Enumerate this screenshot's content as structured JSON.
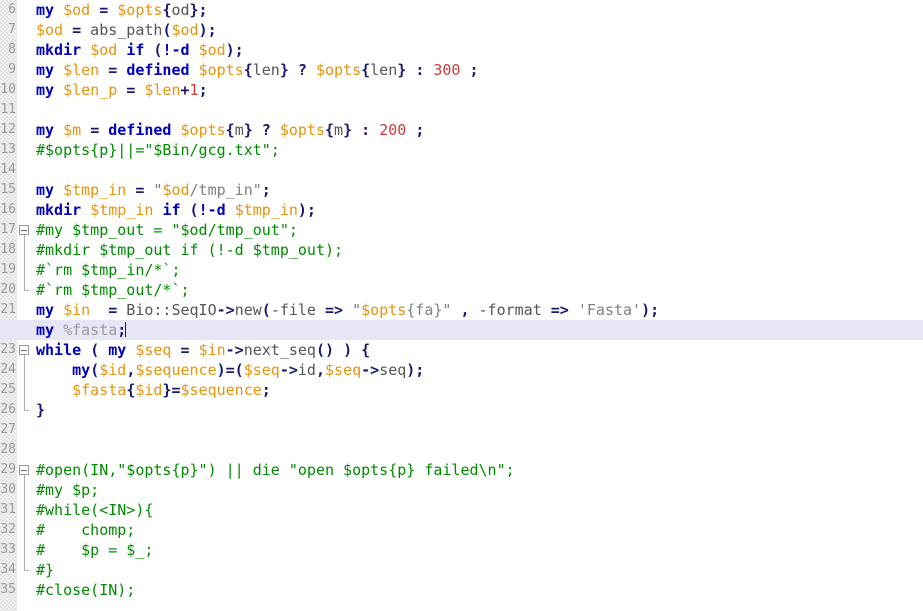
{
  "editor": {
    "language": "Perl",
    "colors": {
      "background": "#ffffff",
      "keyword": "#0000bb",
      "variable": "#e8940c",
      "operator": "#191970",
      "number": "#cc3b3b",
      "comment": "#008c00",
      "string": "#808080",
      "plain": "#555555",
      "current_line": "#e6e6f7",
      "gutter": "#f2f2f2",
      "fold_marker": "#9b9b9b"
    },
    "caret_line_index": 16
  },
  "lines": [
    {
      "number": "6",
      "fold": "none",
      "current": false,
      "tokens": [
        {
          "t": "kw",
          "s": "my"
        },
        {
          "t": "pln",
          "s": " "
        },
        {
          "t": "var",
          "s": "$od"
        },
        {
          "t": "pln",
          "s": " "
        },
        {
          "t": "op",
          "s": "="
        },
        {
          "t": "pln",
          "s": " "
        },
        {
          "t": "var",
          "s": "$opts"
        },
        {
          "t": "op",
          "s": "{"
        },
        {
          "t": "pln",
          "s": "od"
        },
        {
          "t": "op",
          "s": "};"
        }
      ]
    },
    {
      "number": "7",
      "fold": "none",
      "current": false,
      "tokens": [
        {
          "t": "var",
          "s": "$od"
        },
        {
          "t": "pln",
          "s": " "
        },
        {
          "t": "op",
          "s": "="
        },
        {
          "t": "pln",
          "s": " abs_path"
        },
        {
          "t": "op",
          "s": "("
        },
        {
          "t": "var",
          "s": "$od"
        },
        {
          "t": "op",
          "s": ");"
        }
      ]
    },
    {
      "number": "8",
      "fold": "none",
      "current": false,
      "tokens": [
        {
          "t": "kw",
          "s": "mkdir"
        },
        {
          "t": "pln",
          "s": " "
        },
        {
          "t": "var",
          "s": "$od"
        },
        {
          "t": "pln",
          "s": " "
        },
        {
          "t": "kw",
          "s": "if"
        },
        {
          "t": "pln",
          "s": " "
        },
        {
          "t": "op",
          "s": "("
        },
        {
          "t": "kw",
          "s": "!-d"
        },
        {
          "t": "pln",
          "s": " "
        },
        {
          "t": "var",
          "s": "$od"
        },
        {
          "t": "op",
          "s": ");"
        }
      ]
    },
    {
      "number": "9",
      "fold": "none",
      "current": false,
      "tokens": [
        {
          "t": "kw",
          "s": "my"
        },
        {
          "t": "pln",
          "s": " "
        },
        {
          "t": "var",
          "s": "$len"
        },
        {
          "t": "pln",
          "s": " "
        },
        {
          "t": "op",
          "s": "="
        },
        {
          "t": "pln",
          "s": " "
        },
        {
          "t": "kw",
          "s": "defined"
        },
        {
          "t": "pln",
          "s": " "
        },
        {
          "t": "var",
          "s": "$opts"
        },
        {
          "t": "op",
          "s": "{"
        },
        {
          "t": "pln",
          "s": "len"
        },
        {
          "t": "op",
          "s": "}"
        },
        {
          "t": "pln",
          "s": " "
        },
        {
          "t": "op",
          "s": "?"
        },
        {
          "t": "pln",
          "s": " "
        },
        {
          "t": "var",
          "s": "$opts"
        },
        {
          "t": "op",
          "s": "{"
        },
        {
          "t": "pln",
          "s": "len"
        },
        {
          "t": "op",
          "s": "}"
        },
        {
          "t": "pln",
          "s": " "
        },
        {
          "t": "op",
          "s": ":"
        },
        {
          "t": "pln",
          "s": " "
        },
        {
          "t": "num",
          "s": "300"
        },
        {
          "t": "pln",
          "s": " "
        },
        {
          "t": "op",
          "s": ";"
        }
      ]
    },
    {
      "number": "10",
      "fold": "none",
      "current": false,
      "tokens": [
        {
          "t": "kw",
          "s": "my"
        },
        {
          "t": "pln",
          "s": " "
        },
        {
          "t": "var",
          "s": "$len_p"
        },
        {
          "t": "pln",
          "s": " "
        },
        {
          "t": "op",
          "s": "="
        },
        {
          "t": "pln",
          "s": " "
        },
        {
          "t": "var",
          "s": "$len"
        },
        {
          "t": "op",
          "s": "+"
        },
        {
          "t": "num",
          "s": "1"
        },
        {
          "t": "op",
          "s": ";"
        }
      ]
    },
    {
      "number": "11",
      "fold": "none",
      "current": false,
      "tokens": []
    },
    {
      "number": "12",
      "fold": "none",
      "current": false,
      "tokens": [
        {
          "t": "kw",
          "s": "my"
        },
        {
          "t": "pln",
          "s": " "
        },
        {
          "t": "var",
          "s": "$m"
        },
        {
          "t": "pln",
          "s": " "
        },
        {
          "t": "op",
          "s": "="
        },
        {
          "t": "pln",
          "s": " "
        },
        {
          "t": "kw",
          "s": "defined"
        },
        {
          "t": "pln",
          "s": " "
        },
        {
          "t": "var",
          "s": "$opts"
        },
        {
          "t": "op",
          "s": "{"
        },
        {
          "t": "pln",
          "s": "m"
        },
        {
          "t": "op",
          "s": "}"
        },
        {
          "t": "pln",
          "s": " "
        },
        {
          "t": "op",
          "s": "?"
        },
        {
          "t": "pln",
          "s": " "
        },
        {
          "t": "var",
          "s": "$opts"
        },
        {
          "t": "op",
          "s": "{"
        },
        {
          "t": "pln",
          "s": "m"
        },
        {
          "t": "op",
          "s": "}"
        },
        {
          "t": "pln",
          "s": " "
        },
        {
          "t": "op",
          "s": ":"
        },
        {
          "t": "pln",
          "s": " "
        },
        {
          "t": "num",
          "s": "200"
        },
        {
          "t": "pln",
          "s": " "
        },
        {
          "t": "op",
          "s": ";"
        }
      ]
    },
    {
      "number": "13",
      "fold": "none",
      "current": false,
      "tokens": [
        {
          "t": "cmt",
          "s": "#$opts{p}||=\"$Bin/gcg.txt\";"
        }
      ]
    },
    {
      "number": "14",
      "fold": "none",
      "current": false,
      "tokens": []
    },
    {
      "number": "15",
      "fold": "none",
      "current": false,
      "tokens": [
        {
          "t": "kw",
          "s": "my"
        },
        {
          "t": "pln",
          "s": " "
        },
        {
          "t": "var",
          "s": "$tmp_in"
        },
        {
          "t": "pln",
          "s": " "
        },
        {
          "t": "op",
          "s": "="
        },
        {
          "t": "pln",
          "s": " "
        },
        {
          "t": "str",
          "s": "\""
        },
        {
          "t": "var",
          "s": "$od"
        },
        {
          "t": "str",
          "s": "/tmp_in\""
        },
        {
          "t": "op",
          "s": ";"
        }
      ]
    },
    {
      "number": "16",
      "fold": "none",
      "current": false,
      "tokens": [
        {
          "t": "kw",
          "s": "mkdir"
        },
        {
          "t": "pln",
          "s": " "
        },
        {
          "t": "var",
          "s": "$tmp_in"
        },
        {
          "t": "pln",
          "s": " "
        },
        {
          "t": "kw",
          "s": "if"
        },
        {
          "t": "pln",
          "s": " "
        },
        {
          "t": "op",
          "s": "("
        },
        {
          "t": "kw",
          "s": "!-d"
        },
        {
          "t": "pln",
          "s": " "
        },
        {
          "t": "var",
          "s": "$tmp_in"
        },
        {
          "t": "op",
          "s": ");"
        }
      ]
    },
    {
      "number": "17",
      "fold": "start",
      "current": false,
      "tokens": [
        {
          "t": "cmt",
          "s": "#my $tmp_out = \"$od/tmp_out\";"
        }
      ]
    },
    {
      "number": "18",
      "fold": "mid",
      "current": false,
      "tokens": [
        {
          "t": "cmt",
          "s": "#mkdir $tmp_out if (!-d $tmp_out);"
        }
      ]
    },
    {
      "number": "19",
      "fold": "mid",
      "current": false,
      "tokens": [
        {
          "t": "cmt",
          "s": "#`rm $tmp_in/*`;"
        }
      ]
    },
    {
      "number": "20",
      "fold": "end",
      "current": false,
      "tokens": [
        {
          "t": "cmt",
          "s": "#`rm $tmp_out/*`;"
        }
      ]
    },
    {
      "number": "21",
      "fold": "none",
      "current": false,
      "tokens": [
        {
          "t": "kw",
          "s": "my"
        },
        {
          "t": "pln",
          "s": " "
        },
        {
          "t": "var",
          "s": "$in"
        },
        {
          "t": "pln",
          "s": "  "
        },
        {
          "t": "op",
          "s": "="
        },
        {
          "t": "pln",
          "s": " Bio::SeqIO"
        },
        {
          "t": "op",
          "s": "->"
        },
        {
          "t": "pln",
          "s": "new"
        },
        {
          "t": "op",
          "s": "("
        },
        {
          "t": "pln",
          "s": "-file "
        },
        {
          "t": "op",
          "s": "=>"
        },
        {
          "t": "pln",
          "s": " "
        },
        {
          "t": "str",
          "s": "\""
        },
        {
          "t": "var",
          "s": "$opts"
        },
        {
          "t": "str",
          "s": "{fa}\""
        },
        {
          "t": "pln",
          "s": " "
        },
        {
          "t": "op",
          "s": ","
        },
        {
          "t": "pln",
          "s": " -format "
        },
        {
          "t": "op",
          "s": "=>"
        },
        {
          "t": "pln",
          "s": " "
        },
        {
          "t": "str",
          "s": "'Fasta'"
        },
        {
          "t": "op",
          "s": ");"
        }
      ]
    },
    {
      "number": "22",
      "fold": "none",
      "current": true,
      "tokens": [
        {
          "t": "kw",
          "s": "my"
        },
        {
          "t": "pln",
          "s": " "
        },
        {
          "t": "gry",
          "s": "%fasta"
        },
        {
          "t": "op",
          "s": ";"
        },
        {
          "t": "caret",
          "s": ""
        }
      ]
    },
    {
      "number": "23",
      "fold": "start",
      "current": false,
      "tokens": [
        {
          "t": "kw",
          "s": "while"
        },
        {
          "t": "pln",
          "s": " "
        },
        {
          "t": "op",
          "s": "("
        },
        {
          "t": "pln",
          "s": " "
        },
        {
          "t": "kw",
          "s": "my"
        },
        {
          "t": "pln",
          "s": " "
        },
        {
          "t": "var",
          "s": "$seq"
        },
        {
          "t": "pln",
          "s": " "
        },
        {
          "t": "op",
          "s": "="
        },
        {
          "t": "pln",
          "s": " "
        },
        {
          "t": "var",
          "s": "$in"
        },
        {
          "t": "op",
          "s": "->"
        },
        {
          "t": "pln",
          "s": "next_seq"
        },
        {
          "t": "op",
          "s": "()"
        },
        {
          "t": "pln",
          "s": " "
        },
        {
          "t": "op",
          "s": ")"
        },
        {
          "t": "pln",
          "s": " "
        },
        {
          "t": "op",
          "s": "{"
        }
      ]
    },
    {
      "number": "24",
      "fold": "mid",
      "current": false,
      "tokens": [
        {
          "t": "pln",
          "s": "    "
        },
        {
          "t": "kw",
          "s": "my"
        },
        {
          "t": "op",
          "s": "("
        },
        {
          "t": "var",
          "s": "$id"
        },
        {
          "t": "op",
          "s": ","
        },
        {
          "t": "var",
          "s": "$sequence"
        },
        {
          "t": "op",
          "s": ")=("
        },
        {
          "t": "var",
          "s": "$seq"
        },
        {
          "t": "op",
          "s": "->"
        },
        {
          "t": "pln",
          "s": "id"
        },
        {
          "t": "op",
          "s": ","
        },
        {
          "t": "var",
          "s": "$seq"
        },
        {
          "t": "op",
          "s": "->"
        },
        {
          "t": "pln",
          "s": "seq"
        },
        {
          "t": "op",
          "s": ");"
        }
      ]
    },
    {
      "number": "25",
      "fold": "mid",
      "current": false,
      "tokens": [
        {
          "t": "pln",
          "s": "    "
        },
        {
          "t": "var",
          "s": "$fasta"
        },
        {
          "t": "op",
          "s": "{"
        },
        {
          "t": "var",
          "s": "$id"
        },
        {
          "t": "op",
          "s": "}="
        },
        {
          "t": "var",
          "s": "$sequence"
        },
        {
          "t": "op",
          "s": ";"
        }
      ]
    },
    {
      "number": "26",
      "fold": "end",
      "current": false,
      "tokens": [
        {
          "t": "op",
          "s": "}"
        }
      ]
    },
    {
      "number": "27",
      "fold": "none",
      "current": false,
      "tokens": []
    },
    {
      "number": "28",
      "fold": "none",
      "current": false,
      "tokens": []
    },
    {
      "number": "29",
      "fold": "start",
      "current": false,
      "tokens": [
        {
          "t": "cmt",
          "s": "#open(IN,\"$opts{p}\") || die \"open $opts{p} failed\\n\";"
        }
      ]
    },
    {
      "number": "30",
      "fold": "mid",
      "current": false,
      "tokens": [
        {
          "t": "cmt",
          "s": "#my $p;"
        }
      ]
    },
    {
      "number": "31",
      "fold": "mid",
      "current": false,
      "tokens": [
        {
          "t": "cmt",
          "s": "#while(<IN>){"
        }
      ]
    },
    {
      "number": "32",
      "fold": "mid",
      "current": false,
      "tokens": [
        {
          "t": "cmt",
          "s": "#    chomp;"
        }
      ]
    },
    {
      "number": "33",
      "fold": "mid",
      "current": false,
      "tokens": [
        {
          "t": "cmt",
          "s": "#    $p = $_;"
        }
      ]
    },
    {
      "number": "34",
      "fold": "end",
      "current": false,
      "tokens": [
        {
          "t": "cmt",
          "s": "#}"
        }
      ]
    },
    {
      "number": "35",
      "fold": "none",
      "current": false,
      "tokens": [
        {
          "t": "cmt",
          "s": "#close(IN);"
        }
      ]
    }
  ]
}
